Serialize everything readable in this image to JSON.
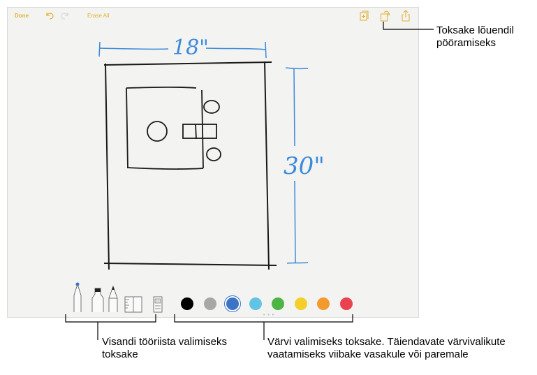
{
  "toolbar": {
    "done_label": "Done",
    "erase_all_label": "Erase All",
    "undo_icon": "undo-icon",
    "redo_icon": "redo-icon",
    "add_page_icon": "add-page-icon",
    "rotate_icon": "rotate-canvas-icon",
    "share_icon": "share-icon"
  },
  "drawing": {
    "width_label": "18\"",
    "height_label": "30\""
  },
  "sketch_tools": [
    {
      "name": "pen-tool",
      "icon": "pen-icon"
    },
    {
      "name": "marker-tool",
      "icon": "marker-icon"
    },
    {
      "name": "pencil-tool",
      "icon": "pencil-icon"
    },
    {
      "name": "ruler-tool",
      "icon": "ruler-icon"
    },
    {
      "name": "eraser-tool",
      "icon": "eraser-icon"
    }
  ],
  "colors": [
    {
      "name": "black",
      "hex": "#000000",
      "selected": false
    },
    {
      "name": "gray",
      "hex": "#a7a7a7",
      "selected": false
    },
    {
      "name": "blue",
      "hex": "#3b74c6",
      "selected": true
    },
    {
      "name": "light-blue",
      "hex": "#62c4e4",
      "selected": false
    },
    {
      "name": "green",
      "hex": "#4db544",
      "selected": false
    },
    {
      "name": "yellow",
      "hex": "#f4cf2c",
      "selected": false
    },
    {
      "name": "orange",
      "hex": "#f39a2e",
      "selected": false
    },
    {
      "name": "red",
      "hex": "#e9434f",
      "selected": false
    }
  ],
  "callouts": {
    "rotate": "Toksake lõuendil pööramiseks",
    "tools": "Visandi tööriista valimiseks toksake",
    "colors": "Värvi valimiseks toksake. Täiendavate värvivalikute vaatamiseks viibake vasakule või paremale"
  },
  "accent_color": "#e2b23a",
  "sketch_ink_color": "#1a1a1a",
  "dimension_ink_color": "#3b8ad9"
}
